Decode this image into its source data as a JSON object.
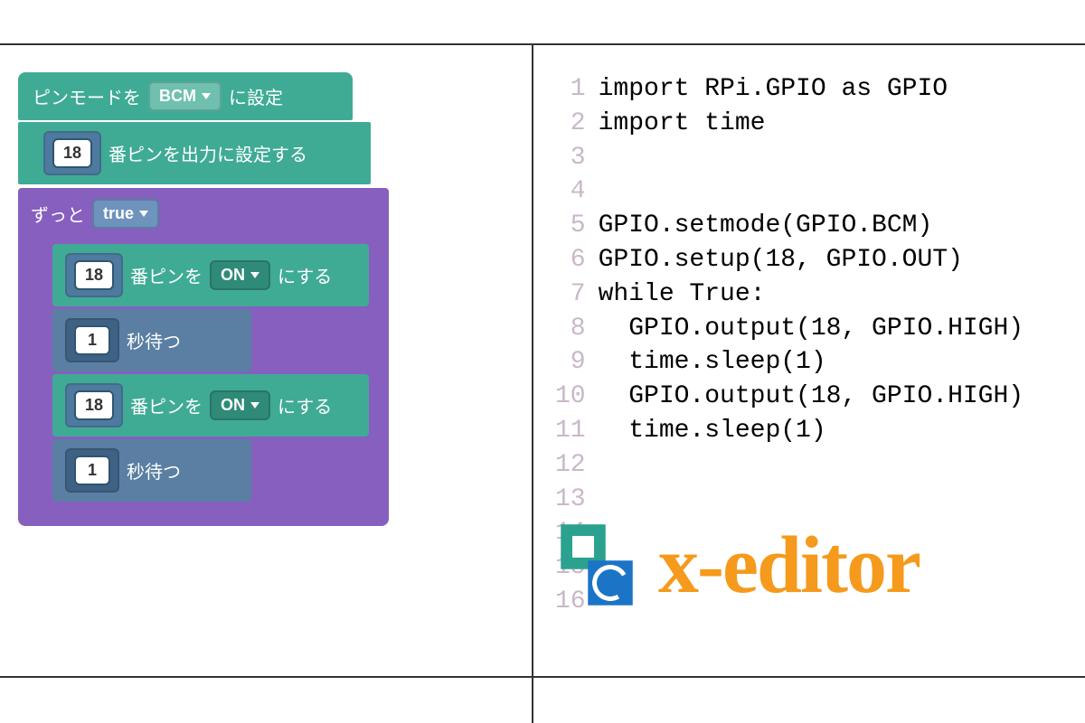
{
  "blocks": {
    "pinmode": {
      "prefix": "ピンモードを",
      "value": "BCM",
      "suffix": "に設定"
    },
    "setup": {
      "pin": "18",
      "label": "番ピンを出力に設定する"
    },
    "loop": {
      "label": "ずっと",
      "condition": "true",
      "body": [
        {
          "type": "output",
          "pin": "18",
          "prefix": "番ピンを",
          "value": "ON",
          "suffix": "にする"
        },
        {
          "type": "wait",
          "seconds": "1",
          "label": "秒待つ"
        },
        {
          "type": "output",
          "pin": "18",
          "prefix": "番ピンを",
          "value": "ON",
          "suffix": "にする"
        },
        {
          "type": "wait",
          "seconds": "1",
          "label": "秒待つ"
        }
      ]
    }
  },
  "code": {
    "lines": [
      "import RPi.GPIO as GPIO",
      "import time",
      "",
      "",
      "GPIO.setmode(GPIO.BCM)",
      "GPIO.setup(18, GPIO.OUT)",
      "while True:",
      "  GPIO.output(18, GPIO.HIGH)",
      "  time.sleep(1)",
      "  GPIO.output(18, GPIO.HIGH)",
      "  time.sleep(1)",
      "",
      "",
      "",
      "",
      ""
    ]
  },
  "logo": {
    "text": "x-editor"
  }
}
